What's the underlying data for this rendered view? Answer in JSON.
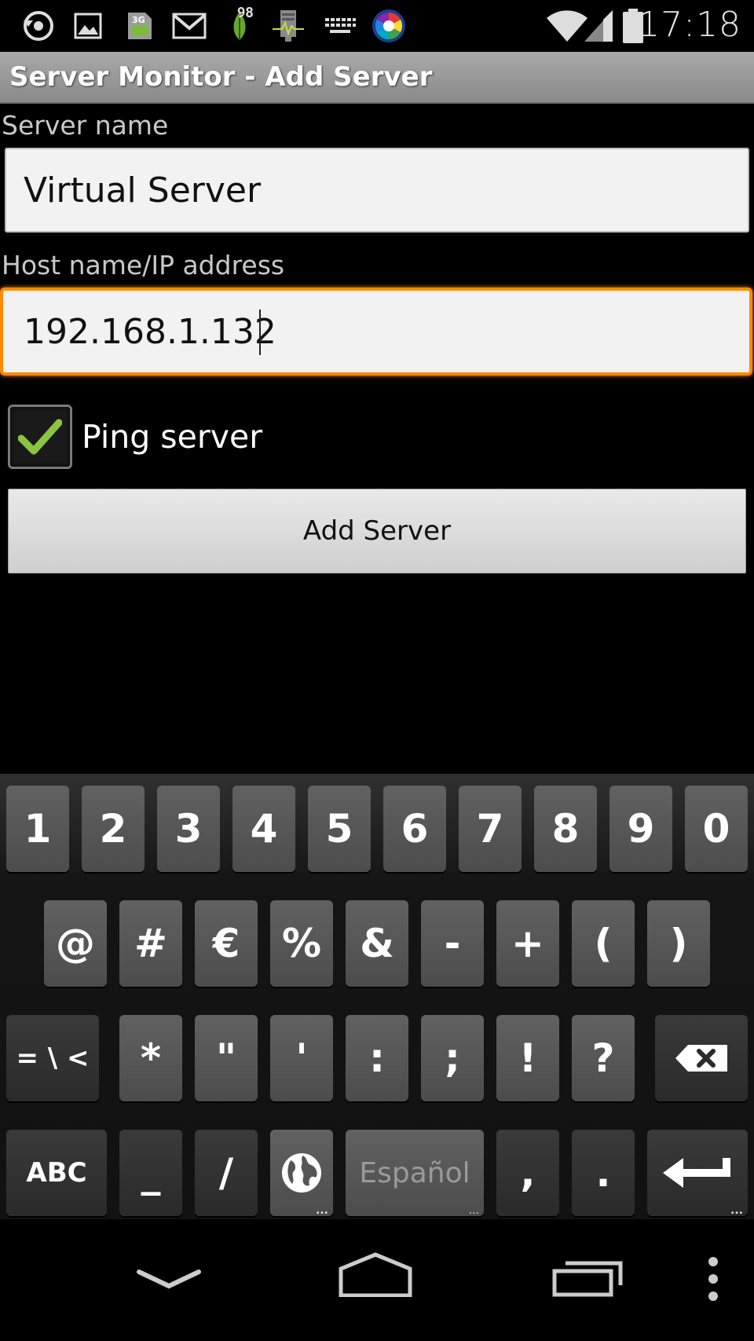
{
  "status_bar": {
    "icons": [
      "sync-icon",
      "image-icon",
      "sim-3g-icon",
      "gmail-icon",
      "leaf-icon",
      "server-monitor-icon",
      "keyboard-icon",
      "color-wheel-icon"
    ],
    "leaf_badge": "98",
    "sim_label": "3G",
    "time": "17:18"
  },
  "titlebar": {
    "title": "Server Monitor - Add Server"
  },
  "form": {
    "server_name_label": "Server name",
    "server_name_value": "Virtual Server",
    "host_label": "Host name/IP address",
    "host_value": "192.168.1.132",
    "ping_label": "Ping server",
    "ping_checked": true,
    "add_button_label": "Add Server"
  },
  "keyboard": {
    "row1": [
      "1",
      "2",
      "3",
      "4",
      "5",
      "6",
      "7",
      "8",
      "9",
      "0"
    ],
    "row2": [
      "@",
      "#",
      "€",
      "%",
      "&",
      "-",
      "+",
      "(",
      ")"
    ],
    "row3": [
      "= \\ <",
      "*",
      "\"",
      "'",
      ":",
      ";",
      "!",
      "?"
    ],
    "row4": {
      "abc": "ABC",
      "underscore": "_",
      "slash": "/",
      "space": "Español",
      "comma": ",",
      "period": "."
    }
  },
  "colors": {
    "focus": "#ff8a00",
    "check": "#8bc53f"
  }
}
